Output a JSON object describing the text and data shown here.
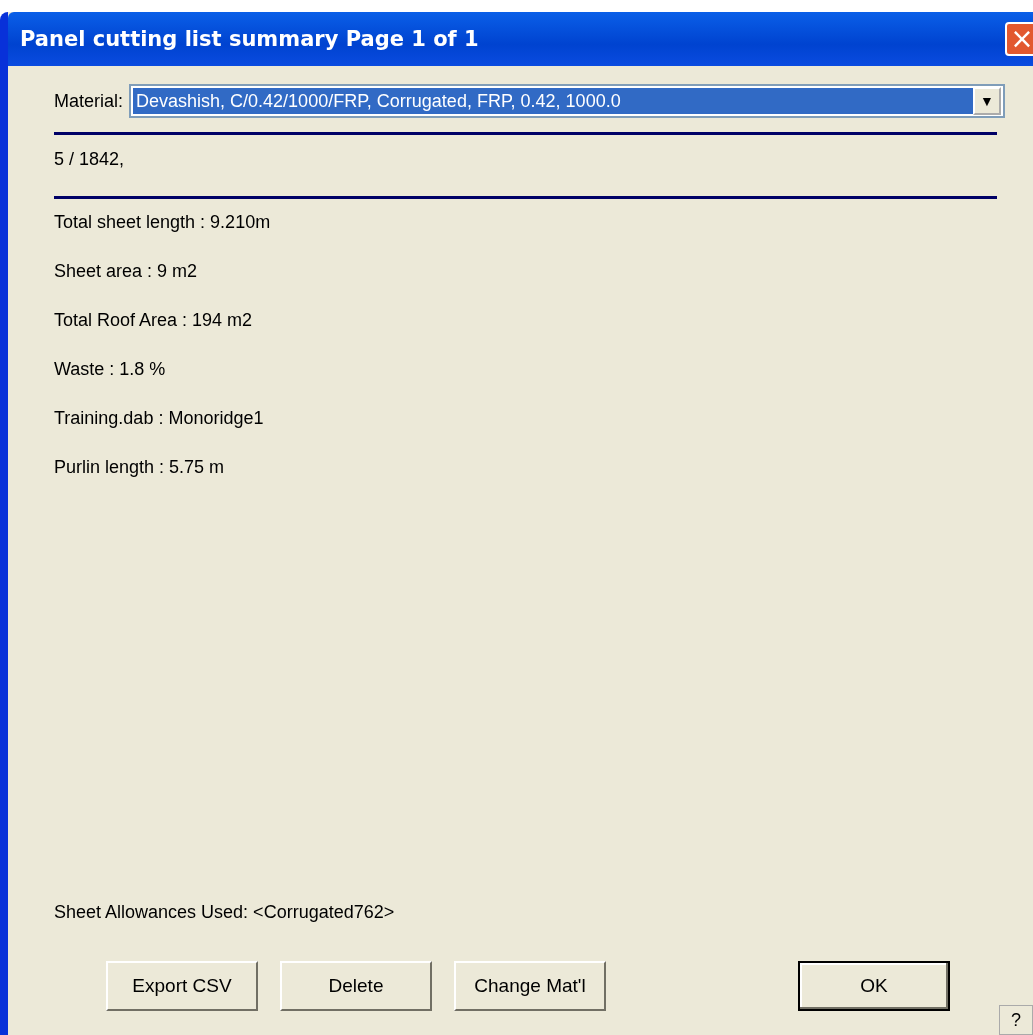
{
  "window": {
    "title": "Panel cutting list summary Page 1 of 1",
    "close": "×"
  },
  "material": {
    "label": "Material:",
    "value": "Devashish, C/0.42/1000/FRP, Corrugated, FRP, 0.42, 1000.0",
    "arrow": "▼"
  },
  "header_line": "5 / 1842,",
  "stats": [
    "Total sheet length : 9.210m",
    "Sheet area : 9 m2",
    "Total Roof Area : 194 m2",
    "Waste : 1.8 %",
    "Training.dab : Monoridge1",
    "Purlin length : 5.75 m"
  ],
  "allowances": "Sheet Allowances Used: <Corrugated762>",
  "buttons": [
    {
      "label": "Export CSV",
      "default": false
    },
    {
      "label": "Delete",
      "default": false
    },
    {
      "label": "Change Mat'l",
      "default": false
    },
    {
      "label": "OK",
      "default": true
    }
  ],
  "help": "?"
}
